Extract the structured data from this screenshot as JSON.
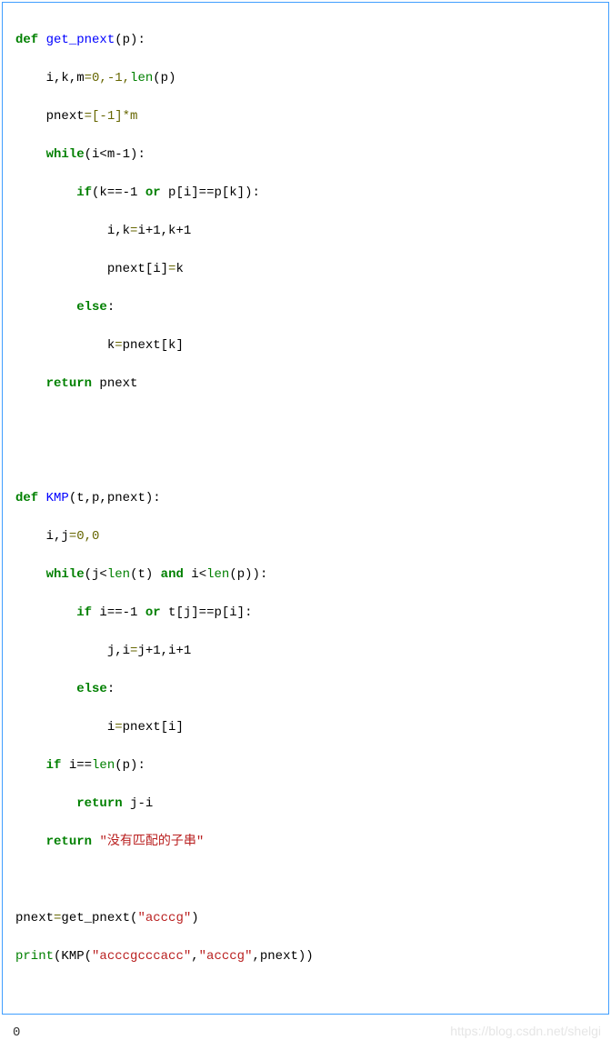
{
  "code": {
    "l1": {
      "kw1": "def ",
      "fn": "get_pnext",
      "p": "(p)",
      "c": ":"
    },
    "l2": {
      "i": "    ",
      "v": "i,k,m",
      "op": "=",
      "e": "0,-1,",
      "b": "len",
      "e2": "(p)"
    },
    "l3": {
      "i": "    ",
      "v": "pnext",
      "op": "=",
      "e": "[-1]*m"
    },
    "l4": {
      "i": "    ",
      "kw": "while",
      "e": "(i<m-1)",
      "c": ":"
    },
    "l5": {
      "i": "        ",
      "kw": "if",
      "e": "(k==-1 ",
      "kw2": "or",
      "e2": " p[i]==p[k])",
      "c": ":"
    },
    "l6": {
      "i": "            ",
      "v": "i,k",
      "op": "=",
      "e": "i+1,k+1"
    },
    "l7": {
      "i": "            ",
      "v": "pnext[i]",
      "op": "=",
      "e": "k"
    },
    "l8": {
      "i": "        ",
      "kw": "else",
      "c": ":"
    },
    "l9": {
      "i": "            ",
      "v": "k",
      "op": "=",
      "e": "pnext[k]"
    },
    "l10": {
      "i": "    ",
      "kw": "return",
      "e": " pnext"
    },
    "l11": {
      "blank": " "
    },
    "l12": {
      "blank": " "
    },
    "l13": {
      "kw1": "def ",
      "fn": "KMP",
      "p": "(t,p,pnext)",
      "c": ":"
    },
    "l14": {
      "i": "    ",
      "v": "i,j",
      "op": "=",
      "e": "0,0"
    },
    "l15": {
      "i": "    ",
      "kw": "while",
      "e": "(j<",
      "b": "len",
      "e2": "(t) ",
      "kw2": "and",
      "e3": " i<",
      "b2": "len",
      "e4": "(p))",
      "c": ":"
    },
    "l16": {
      "i": "        ",
      "kw": "if",
      "e": " i==-1 ",
      "kw2": "or",
      "e2": " t[j]==p[i]",
      "c": ":"
    },
    "l17": {
      "i": "            ",
      "v": "j,i",
      "op": "=",
      "e": "j+1,i+1"
    },
    "l18": {
      "i": "        ",
      "kw": "else",
      "c": ":"
    },
    "l19": {
      "i": "            ",
      "v": "i",
      "op": "=",
      "e": "pnext[i]"
    },
    "l20": {
      "i": "    ",
      "kw": "if",
      "e": " i==",
      "b": "len",
      "e2": "(p)",
      "c": ":"
    },
    "l21": {
      "i": "        ",
      "kw": "return",
      "e": " j-i"
    },
    "l22": {
      "i": "    ",
      "kw": "return",
      "e": " ",
      "s": "\"没有匹配的子串\""
    },
    "l23": {
      "blank": " "
    },
    "l24": {
      "v": "pnext",
      "op": "=",
      "e": "get_pnext(",
      "s": "\"acccg\"",
      "e2": ")"
    },
    "l25": {
      "b": "print",
      "e": "(KMP(",
      "s": "\"acccgcccacc\"",
      "e2": ",",
      "s2": "\"acccg\"",
      "e3": ",pnext))"
    }
  },
  "output": "0",
  "watermark": "https://blog.csdn.net/shelgi"
}
